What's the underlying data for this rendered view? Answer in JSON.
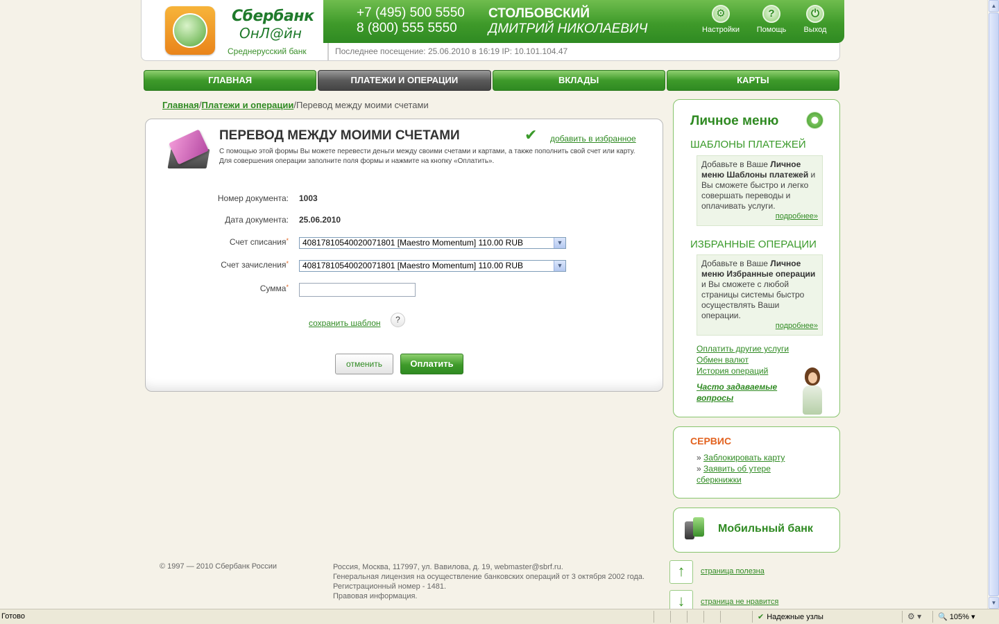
{
  "header": {
    "logo_line1": "Сбербанк",
    "logo_line2": "ОнЛ@йн",
    "bank_region": "Среднерусский банк",
    "phone1": "+7 (495) 500 5550",
    "phone2": "8 (800) 555 5550",
    "user_last": "СТОЛБОВСКИЙ",
    "user_first": "ДМИТРИЙ НИКОЛАЕВИЧ",
    "settings_label": "Настройки",
    "help_label": "Помощь",
    "exit_label": "Выход",
    "last_visit": "Последнее посещение: 25.06.2010 в 16:19 IP: 10.101.104.47"
  },
  "nav": {
    "items": [
      {
        "label": "ГЛАВНАЯ"
      },
      {
        "label": "ПЛАТЕЖИ И ОПЕРАЦИИ"
      },
      {
        "label": "ВКЛАДЫ"
      },
      {
        "label": "КАРТЫ"
      }
    ]
  },
  "breadcrumb": {
    "home": "Главная",
    "sep": "/",
    "payments": "Платежи и операции",
    "current": "Перевод между моими счетами"
  },
  "form": {
    "title": "ПЕРЕВОД МЕЖДУ МОИМИ СЧЕТАМИ",
    "description": "С помощью этой формы Вы можете перевести деньги между своими счетами и картами, а также пополнить свой счет или карту. Для совершения операции заполните поля формы и нажмите на кнопку «Оплатить».",
    "add_favorite": "добавить в избранное",
    "doc_number_label": "Номер документа:",
    "doc_number": "1003",
    "doc_date_label": "Дата документа:",
    "doc_date": "25.06.2010",
    "from_label": "Счет списания",
    "from_value": "40817810540020071801 [Maestro Momentum] 110.00 RUB",
    "to_label": "Счет зачисления",
    "to_value": "40817810540020071801 [Maestro Momentum] 110.00 RUB",
    "amount_label": "Сумма",
    "required_mark": "*",
    "amount_value": "",
    "save_template": "сохранить шаблон",
    "help_mark": "?",
    "cancel": "отменить",
    "pay": "Оплатить"
  },
  "personal_menu": {
    "title": "Личное меню",
    "templates_title": "ШАБЛОНЫ ПЛАТЕЖЕЙ",
    "templates_note_1": "Добавьте в Ваше ",
    "templates_note_bold": "Личное меню Шаблоны платежей",
    "templates_note_2": " и Вы сможете быстро и легко совершать переводы и оплачивать услуги.",
    "more": "подробнее»",
    "favorites_title": "ИЗБРАННЫЕ ОПЕРАЦИИ",
    "favorites_note_1": "Добавьте в Ваше ",
    "favorites_note_bold": "Личное меню Избранные операции",
    "favorites_note_2": " и Вы сможете с любой страницы системы быстро осуществлять Ваши операции.",
    "link_other": "Оплатить другие услуги",
    "link_exchange": "Обмен валют",
    "link_history": "История операций",
    "faq": "Часто задаваемые вопросы"
  },
  "service": {
    "title": "СЕРВИС",
    "bullet": "»",
    "block_card": "Заблокировать карту",
    "report_loss": "Заявить об утере сберкнижки"
  },
  "mobile": {
    "title": "Мобильный банк"
  },
  "feedback": {
    "useful": "страница полезна",
    "not_like": "страница не нравится"
  },
  "footer": {
    "copyright": "© 1997 — 2010 Сбербанк России",
    "addr1": "Россия, Москва, 117997, ул. Вавилова, д. 19, webmaster@sbrf.ru.",
    "addr2": "Генеральная лицензия на осуществление банковских операций от 3 октября 2002 года.",
    "addr3": "Регистрационный номер - 1481.",
    "addr4": "Правовая информация."
  },
  "statusbar": {
    "ready": "Готово",
    "trusted": "Надежные узлы",
    "zoom": "105%"
  }
}
